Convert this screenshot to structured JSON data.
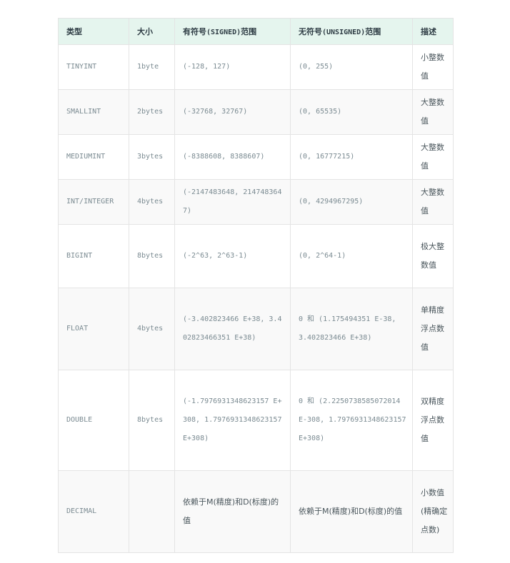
{
  "table": {
    "headers": {
      "type": "类型",
      "size": "大小",
      "signed_prefix": "有符号",
      "signed_code": "(SIGNED)",
      "signed_suffix": "范围",
      "unsigned_prefix": "无符号",
      "unsigned_code": "(UNSIGNED)",
      "unsigned_suffix": "范围",
      "desc": "描述"
    },
    "rows": [
      {
        "type": "TINYINT",
        "size": "1byte",
        "signed": "(-128, 127)",
        "unsigned": "(0, 255)",
        "desc": "小整数值"
      },
      {
        "type": "SMALLINT",
        "size": "2bytes",
        "signed": "(-32768, 32767)",
        "unsigned": "(0, 65535)",
        "desc": "大整数值"
      },
      {
        "type": "MEDIUMINT",
        "size": "3bytes",
        "signed": "(-8388608, 8388607)",
        "unsigned": "(0, 16777215)",
        "desc": "大整数值"
      },
      {
        "type": "INT/INTEGER",
        "size": "4bytes",
        "signed": "(-2147483648, 2147483647)",
        "unsigned": "(0, 4294967295)",
        "desc": "大整数值"
      },
      {
        "type": "BIGINT",
        "size": "8bytes",
        "signed": "(-2^63, 2^63-1)",
        "unsigned": "(0, 2^64-1)",
        "desc": "极大整数值"
      },
      {
        "type": "FLOAT",
        "size": "4bytes",
        "signed": "(-3.402823466 E+38, 3.402823466351 E+38)",
        "unsigned": "0 和 (1.175494351 E-38, 3.402823466 E+38)",
        "desc": "单精度浮点数值"
      },
      {
        "type": "DOUBLE",
        "size": "8bytes",
        "signed": "(-1.7976931348623157 E+308, 1.7976931348623157 E+308)",
        "unsigned": "0 和 (2.2250738585072014 E-308, 1.7976931348623157 E+308)",
        "desc": "双精度浮点数值"
      },
      {
        "type": "DECIMAL",
        "size": "",
        "signed": "依赖于M(精度)和D(标度)的值",
        "unsigned": "依赖于M(精度)和D(标度)的值",
        "desc": "小数值(精确定点数)"
      }
    ]
  }
}
